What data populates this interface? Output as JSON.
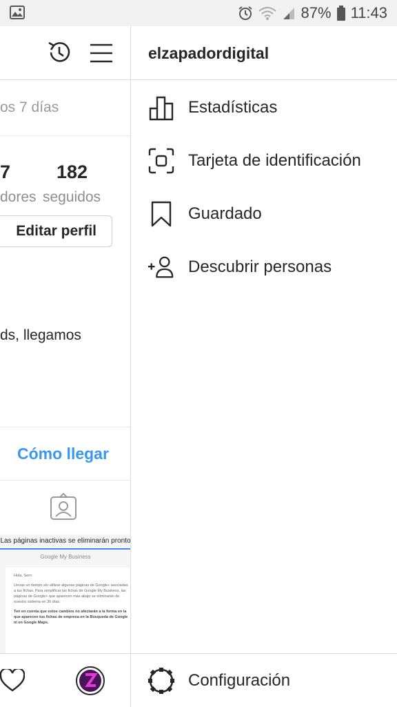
{
  "status_bar": {
    "battery": "87%",
    "time": "11:43",
    "icons": [
      "image-icon",
      "alarm-icon",
      "wifi-icon",
      "signal-icon",
      "battery-icon"
    ]
  },
  "profile_background": {
    "header_icons": [
      "history-icon",
      "hamburger-menu-icon"
    ],
    "weekly_text": "os 7 días",
    "stats": [
      {
        "number": "7",
        "label": "dores"
      },
      {
        "number": "182",
        "label": "seguidos"
      }
    ],
    "edit_profile_label": "Editar perfil",
    "bio_text": "ds, llegamos",
    "directions_label": "Cómo llegar",
    "tagged_icon": "tagged-person-icon",
    "post": {
      "title": "Las páginas inactivas se eliminarán pronto",
      "brand": "Google My Business",
      "greeting": "Hola, Sem:",
      "body": "Llevas un tiempo sin utilizar algunas páginas de Google+ asociadas a tus fichas. Para simplificar las fichas de Google My Business, las páginas de Google+ que aparecen más abajo se eliminarán de nuestro sistema en 30 días.",
      "note": "Ten en cuenta que estos cambios no afectarán a la forma en la que aparecen tus fichas de empresa en la Búsqueda de Google ni en Google Maps."
    },
    "bottom_nav_icons": [
      "heart-icon",
      "profile-avatar"
    ]
  },
  "drawer": {
    "username": "elzapadordigital",
    "items": [
      {
        "label": "Estadísticas",
        "icon": "bar-chart-icon"
      },
      {
        "label": "Tarjeta de identificación",
        "icon": "nametag-scan-icon"
      },
      {
        "label": "Guardado",
        "icon": "bookmark-icon"
      },
      {
        "label": "Descubrir personas",
        "icon": "add-person-icon"
      }
    ],
    "footer": {
      "label": "Configuración",
      "icon": "settings-gear-icon"
    }
  },
  "colors": {
    "link_blue": "#3897f0",
    "text": "#262626",
    "muted": "#8e8e8e",
    "divider": "#dbdbdb"
  }
}
